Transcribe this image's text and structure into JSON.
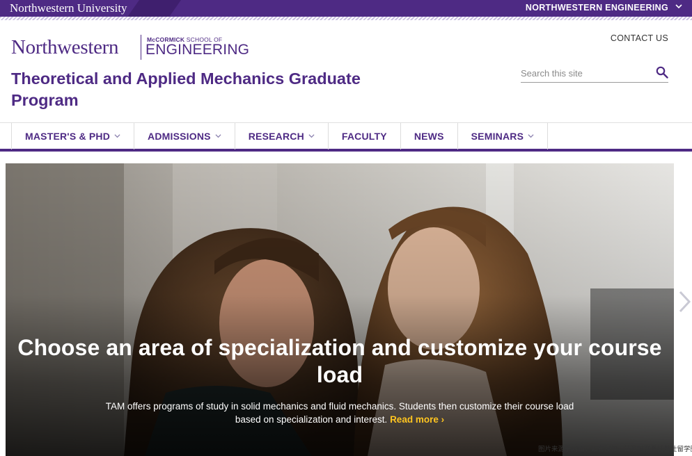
{
  "topbar": {
    "university": "Northwestern University",
    "engineering_menu": "NORTHWESTERN ENGINEERING",
    "chevron": "⌄"
  },
  "header": {
    "logo": {
      "northwestern": "Northwestern",
      "mccormick_bold": "McCORMICK",
      "school_of": " SCHOOL OF",
      "engineering": "ENGINEERING"
    },
    "site_title": "Theoretical and Applied Mechanics Graduate Program",
    "contact_link": "CONTACT US",
    "search": {
      "placeholder": "Search this site",
      "icon": "search-icon"
    }
  },
  "nav": {
    "items": [
      {
        "label": "MASTER'S & PHD",
        "has_dropdown": true
      },
      {
        "label": "ADMISSIONS",
        "has_dropdown": true
      },
      {
        "label": "RESEARCH",
        "has_dropdown": true
      },
      {
        "label": "FACULTY",
        "has_dropdown": false
      },
      {
        "label": "NEWS",
        "has_dropdown": false
      },
      {
        "label": "SEMINARS",
        "has_dropdown": true
      }
    ],
    "dropdown_glyph": "⌄"
  },
  "hero": {
    "headline": "Choose an area of specialization and customize your course load",
    "body": "TAM offers programs of study in solid mechanics and fluid mechanics. Students then customize their course load based on specialization and interest. ",
    "read_more": "Read more ›",
    "next_icon": "chevron-right-icon"
  },
  "watermark": "图片来源于网络，如有侵权，请及时联系托普仕留学删除",
  "colors": {
    "brand_purple": "#4e2a84",
    "accent_gold": "#ffc520",
    "white": "#ffffff"
  }
}
